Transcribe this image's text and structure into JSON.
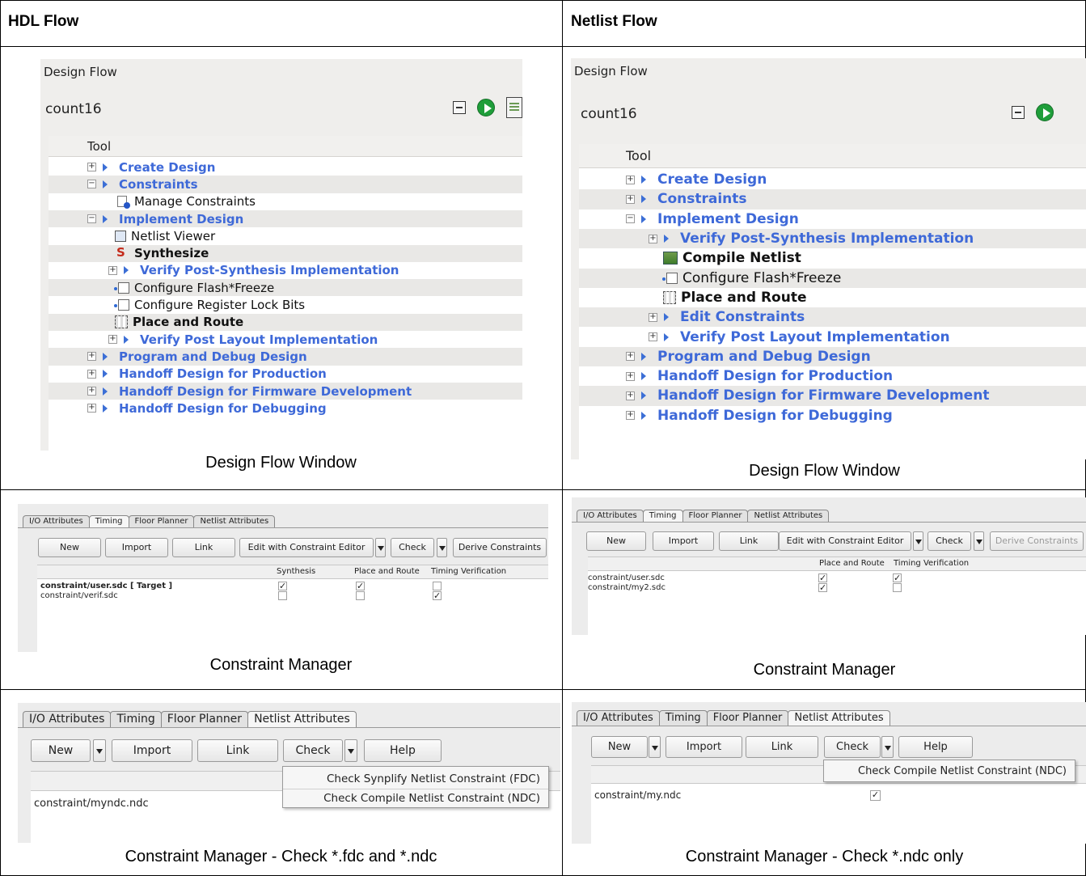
{
  "headers": {
    "left": "HDL Flow",
    "right": "Netlist Flow"
  },
  "captions": {
    "design_flow_left": "Design Flow Window",
    "design_flow_right": "Design Flow Window",
    "cm_left": "Constraint Manager",
    "cm_right": "Constraint Manager",
    "check_left": "Constraint Manager - Check *.fdc and *.ndc",
    "check_right": "Constraint Manager - Check *.ndc only"
  },
  "design_flow": {
    "title": "Design Flow",
    "project": "count16",
    "column": "Tool",
    "icons": [
      "collapse-icon",
      "run-icon",
      "report-icon"
    ]
  },
  "hdl_tree": [
    {
      "label": "Create Design",
      "kind": "group"
    },
    {
      "label": "Constraints",
      "kind": "group"
    },
    {
      "label": "Manage Constraints",
      "kind": "tool"
    },
    {
      "label": "Implement Design",
      "kind": "group"
    },
    {
      "label": "Netlist Viewer",
      "kind": "tool"
    },
    {
      "label": "Synthesize",
      "kind": "tool-bold"
    },
    {
      "label": "Verify Post-Synthesis Implementation",
      "kind": "group"
    },
    {
      "label": "Configure Flash*Freeze",
      "kind": "tool"
    },
    {
      "label": "Configure Register Lock Bits",
      "kind": "tool"
    },
    {
      "label": "Place and Route",
      "kind": "tool-bold"
    },
    {
      "label": "Verify Post Layout Implementation",
      "kind": "group"
    },
    {
      "label": "Program and Debug Design",
      "kind": "group"
    },
    {
      "label": "Handoff Design for Production",
      "kind": "group"
    },
    {
      "label": "Handoff Design for Firmware Development",
      "kind": "group"
    },
    {
      "label": "Handoff Design for Debugging",
      "kind": "group"
    }
  ],
  "netlist_tree": [
    {
      "label": "Create Design",
      "kind": "group"
    },
    {
      "label": "Constraints",
      "kind": "group"
    },
    {
      "label": "Implement Design",
      "kind": "group"
    },
    {
      "label": "Verify Post-Synthesis Implementation",
      "kind": "group"
    },
    {
      "label": "Compile Netlist",
      "kind": "tool-bold"
    },
    {
      "label": "Configure Flash*Freeze",
      "kind": "tool"
    },
    {
      "label": "Place and Route",
      "kind": "tool-bold"
    },
    {
      "label": "Edit Constraints",
      "kind": "group"
    },
    {
      "label": "Verify Post Layout Implementation",
      "kind": "group"
    },
    {
      "label": "Program and Debug Design",
      "kind": "group"
    },
    {
      "label": "Handoff Design for Production",
      "kind": "group"
    },
    {
      "label": "Handoff Design for Firmware Development",
      "kind": "group"
    },
    {
      "label": "Handoff Design for Debugging",
      "kind": "group"
    }
  ],
  "tabs": [
    "I/O Attributes",
    "Timing",
    "Floor Planner",
    "Netlist Attributes"
  ],
  "timing_left": {
    "buttons": {
      "new": "New",
      "import": "Import",
      "link": "Link",
      "edit": "Edit with Constraint Editor",
      "check": "Check",
      "derive": "Derive Constraints"
    },
    "columns": [
      "Synthesis",
      "Place and Route",
      "Timing Verification"
    ],
    "rows": [
      {
        "file": "constraint/user.sdc  [ Target ]",
        "checks": [
          true,
          true,
          false
        ]
      },
      {
        "file": "constraint/verif.sdc",
        "checks": [
          false,
          false,
          true
        ]
      }
    ]
  },
  "timing_right": {
    "buttons": {
      "new": "New",
      "import": "Import",
      "link": "Link",
      "edit": "Edit with Constraint Editor",
      "check": "Check",
      "derive": "Derive Constraints"
    },
    "columns": [
      "Place and Route",
      "Timing Verification"
    ],
    "rows": [
      {
        "file": "constraint/user.sdc",
        "checks": [
          true,
          true
        ]
      },
      {
        "file": "constraint/my2.sdc",
        "checks": [
          true,
          false
        ]
      }
    ]
  },
  "netlist_left": {
    "buttons": {
      "new": "New",
      "import": "Import",
      "link": "Link",
      "check": "Check",
      "help": "Help"
    },
    "menu": [
      "Check Synplify Netlist Constraint (FDC)",
      "Check Compile Netlist Constraint (NDC)"
    ],
    "file": "constraint/myndc.ndc"
  },
  "netlist_right": {
    "buttons": {
      "new": "New",
      "import": "Import",
      "link": "Link",
      "check": "Check",
      "help": "Help"
    },
    "menu": [
      "Check Compile Netlist Constraint (NDC)"
    ],
    "file": "constraint/my.ndc",
    "checked": true
  }
}
